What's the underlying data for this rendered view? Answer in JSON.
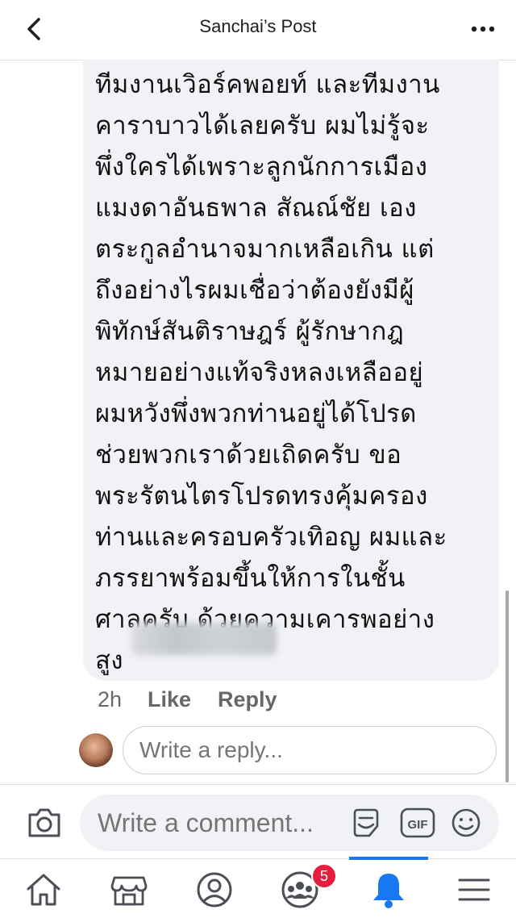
{
  "header": {
    "title": "Sanchai’s Post",
    "back_icon": "chevron-left-icon",
    "more_icon": "more-horizontal-icon"
  },
  "comment": {
    "text": "ทีมงานเวิอร์คพอยท์ และทีมงาน\nคาราบาวได้เลยครับ ผมไม่รู้จะ\nพึ่งใครได้เพราะลูกนักการเมือง\nแมงดาอันธพาล สัณณ์ชัย เอง\nตระกูลอำนาจมากเหลือเกิน แต่\nถึงอย่างไรผมเชื่อว่าต้องยังมีผู้\nพิทักษ์สันติราษฎร์ ผู้รักษากฎ\nหมายอย่างแท้จริงหลงเหลืออยู่\nผมหวังพึ่งพวกท่านอยู่ได้โปรด\nช่วยพวกเราด้วยเถิดครับ ขอ\nพระรัตนไตรโปรดทรงคุ้มครอง\nท่านและครอบครัวเทิอญ ผมและ\nภรรยาพร้อมขึ้นให้การในชั้น\nศาลครับ ด้วยความเคารพอย่าง\nสูง",
    "time": "2h",
    "like_label": "Like",
    "reply_label": "Reply"
  },
  "reply_box": {
    "placeholder": "Write a reply..."
  },
  "composer": {
    "placeholder": "Write a comment...",
    "camera_icon": "camera-icon",
    "sticker_icon": "sticker-icon",
    "gif_label": "GIF",
    "emoji_icon": "emoji-icon"
  },
  "nav": {
    "items": [
      {
        "icon": "home-icon"
      },
      {
        "icon": "marketplace-icon"
      },
      {
        "icon": "profile-icon"
      },
      {
        "icon": "groups-icon",
        "badge": "5"
      },
      {
        "icon": "notifications-icon",
        "active": true
      },
      {
        "icon": "menu-icon"
      }
    ]
  },
  "colors": {
    "accent": "#1877f2",
    "badge": "#e41e3f",
    "bubble": "#f0f2f5",
    "secondary_text": "#65676b"
  }
}
